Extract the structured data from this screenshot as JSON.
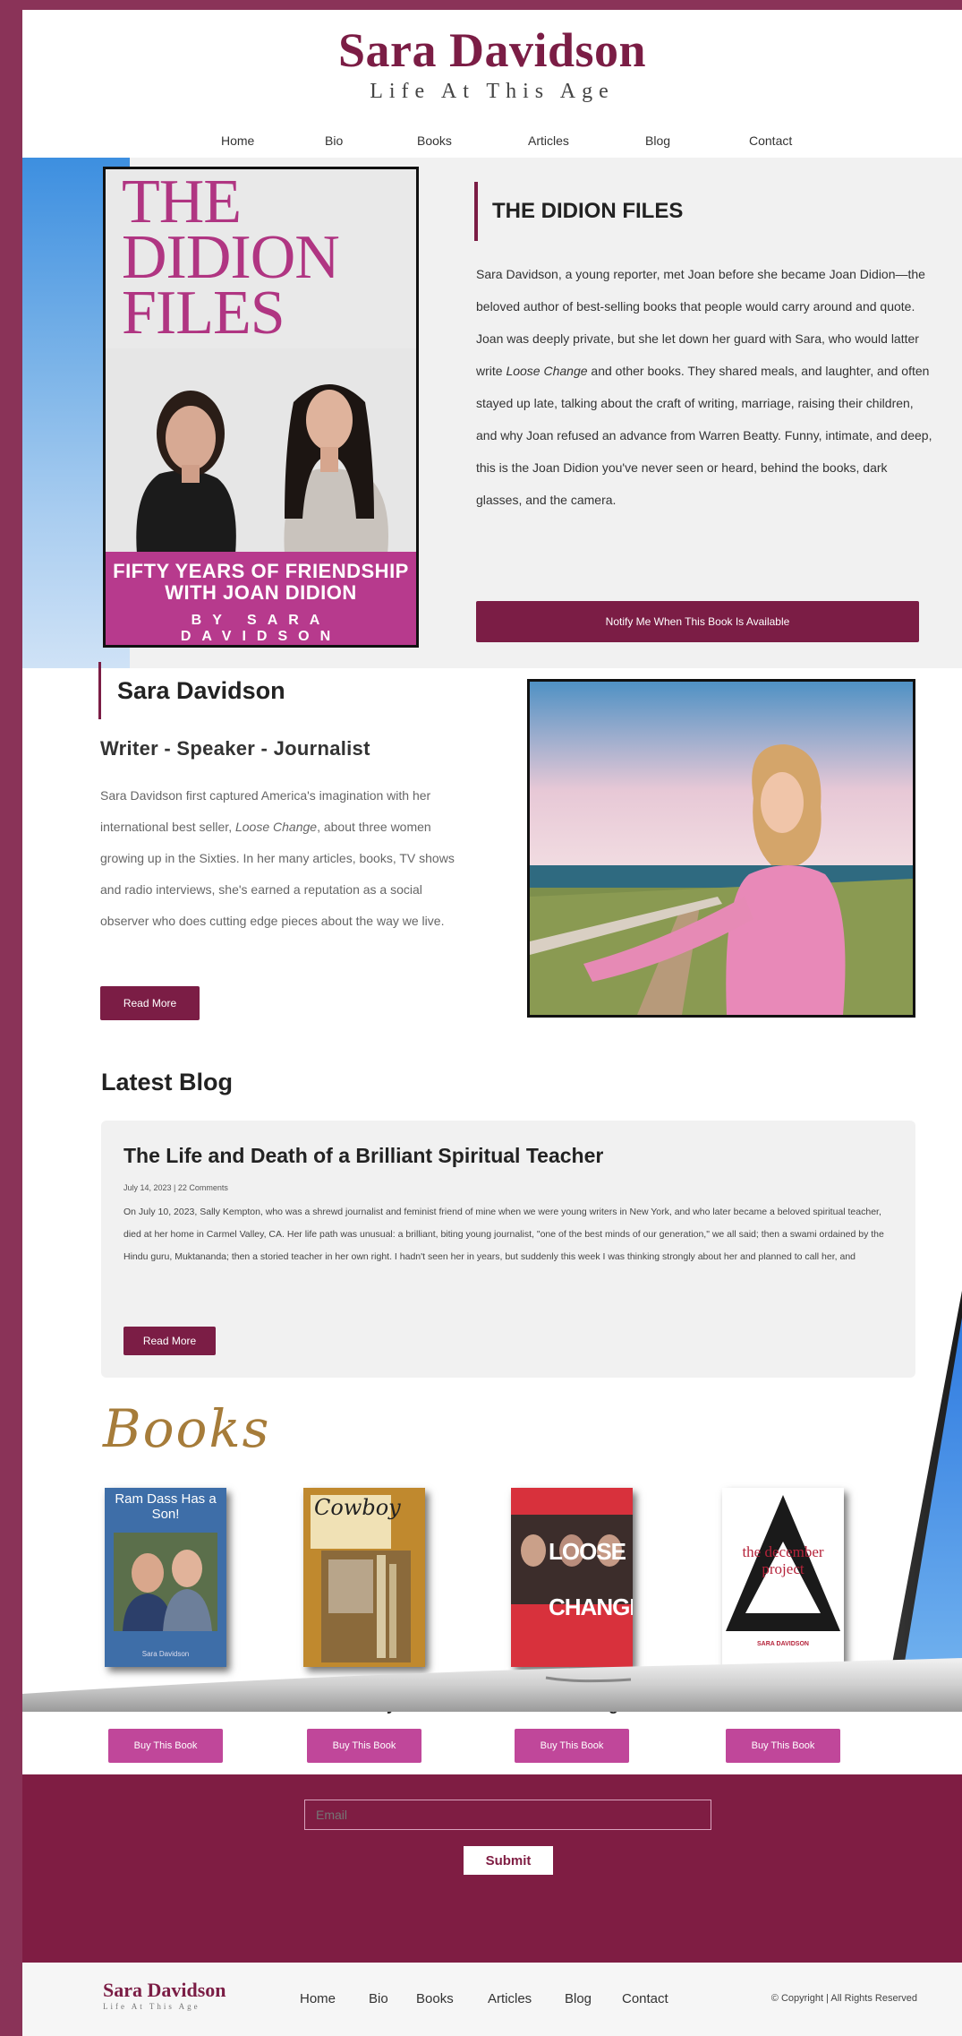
{
  "brand": {
    "name": "Sara Davidson",
    "tagline": "Life At This Age"
  },
  "nav": [
    "Home",
    "Bio",
    "Books",
    "Articles",
    "Blog",
    "Contact"
  ],
  "hero": {
    "cover": {
      "title_lines": [
        "THE",
        "DIDION",
        "FILES"
      ],
      "subtitle_lines": [
        "FIFTY YEARS OF FRIENDSHIP",
        "WITH JOAN DIDION"
      ],
      "byline": "BY SARA DAVIDSON"
    },
    "title": "THE DIDION FILES",
    "text_before": "Sara Davidson, a young reporter, met Joan before she became Joan Didion—the beloved author of best-selling books that people would carry around and quote. Joan was deeply private, but she let down her guard with Sara, who would latter write ",
    "text_italic": "Loose Change",
    "text_after": " and other books. They shared meals, and laughter, and often stayed up late, talking about the craft of writing, marriage, raising their children, and why Joan refused an advance from Warren Beatty. Funny, intimate, and deep, this is the Joan Didion you've never seen or heard, behind the books, dark glasses, and the camera.",
    "notify_label": "Notify Me When This Book Is Available"
  },
  "about": {
    "title": "Sara Davidson",
    "subtitle": "Writer - Speaker - Journalist",
    "text_before": "Sara Davidson first captured America's imagination with her international best seller, ",
    "text_italic": "Loose Change",
    "text_after": ", about three women growing up in the Sixties. In her many articles, books, TV shows and radio interviews, she's earned a reputation as a social observer who does cutting edge pieces about the way we live.",
    "read_more": "Read More"
  },
  "blog": {
    "heading": "Latest Blog",
    "post": {
      "title": "The Life and Death of a Brilliant Spiritual Teacher",
      "meta": "July 14, 2023 | 22 Comments",
      "excerpt": "On July 10, 2023, Sally Kempton, who was a shrewd journalist and feminist friend of mine when we were young writers in New York, and who later became a beloved spiritual teacher, died at her home in Carmel Valley, CA. Her life path was unusual: a brilliant, biting young journalist, \"one of the best minds of our generation,\" we all said; then a swami ordained by the Hindu guru, Muktananda; then a storied teacher in her own right. I hadn't seen her in years, but suddenly this week I was thinking strongly about her and planned to call her, and",
      "read_more": "Read More"
    }
  },
  "books": {
    "heading": "Books",
    "items": [
      {
        "name": "Ram Dass has a Son",
        "cover_text": "Ram Dass Has a Son!",
        "cover_author": "Sara Davidson",
        "buy": "Buy This Book"
      },
      {
        "name": "Cowboy",
        "cover_text": "Cowboy",
        "cover_author": "",
        "buy": "Buy This Book"
      },
      {
        "name": "Loose Change",
        "cover_text": "LOOSE CHANGE",
        "cover_author": "",
        "buy": "Buy This Book"
      },
      {
        "name": "The December Pr",
        "cover_text": "the december project",
        "cover_author": "SARA DAVIDSON",
        "buy": "Buy This Book"
      }
    ]
  },
  "newsletter": {
    "email_placeholder": "Email",
    "submit": "Submit"
  },
  "footer": {
    "name": "Sara Davidson",
    "tagline": "Life At This Age",
    "nav": [
      "Home",
      "Bio",
      "Books",
      "Articles",
      "Blog",
      "Contact"
    ],
    "copyright": "© Copyright | All Rights Reserved"
  },
  "colors": {
    "accent": "#7b1d45",
    "outer": "#8a3358",
    "buy": "#c0479a",
    "books_heading": "#a67c3a"
  }
}
